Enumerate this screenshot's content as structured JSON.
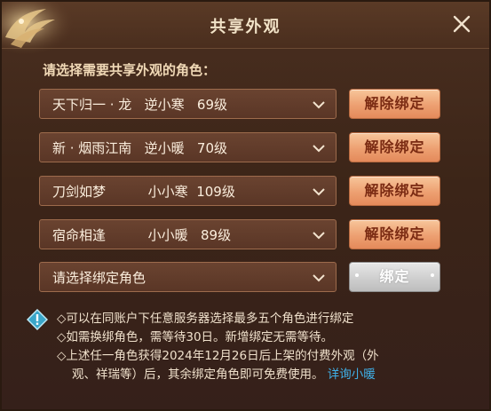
{
  "dialog": {
    "title": "共享外观",
    "prompt": "请选择需要共享外观的角色："
  },
  "rows": [
    {
      "select_text": "天下归一 · 龙   逆小寒   69级",
      "button_label": "解除绑定"
    },
    {
      "select_text": "新 · 烟雨江南   逆小暖   70级",
      "button_label": "解除绑定"
    },
    {
      "select_text": "刀剑如梦          小小寒  109级",
      "button_label": "解除绑定"
    },
    {
      "select_text": "宿命相逢          小小暖   89级",
      "button_label": "解除绑定"
    },
    {
      "select_text": "请选择绑定角色",
      "button_label": "绑定"
    }
  ],
  "notes": {
    "line1": "◇可以在同账户下任意服务器选择最多五个角色进行绑定",
    "line2": "◇如需换绑角色，需等待30日。新增绑定无需等待。",
    "line3": "◇上述任一角色获得2024年12月26日后上架的付费外观（外",
    "line4": "观、祥瑞等）后，其余绑定角色即可免费使用。",
    "link": "详询小暖"
  },
  "colors": {
    "panel_bg": "#3c2518",
    "title_text": "#f2e3c8",
    "unbind_button": "#eda071",
    "bind_button": "#cfcfcf",
    "link": "#3fb0e8"
  },
  "icons": {
    "close": "close-icon",
    "dropdown": "chevron-down-icon",
    "info": "info-diamond-icon",
    "logo": "phoenix-logo"
  }
}
